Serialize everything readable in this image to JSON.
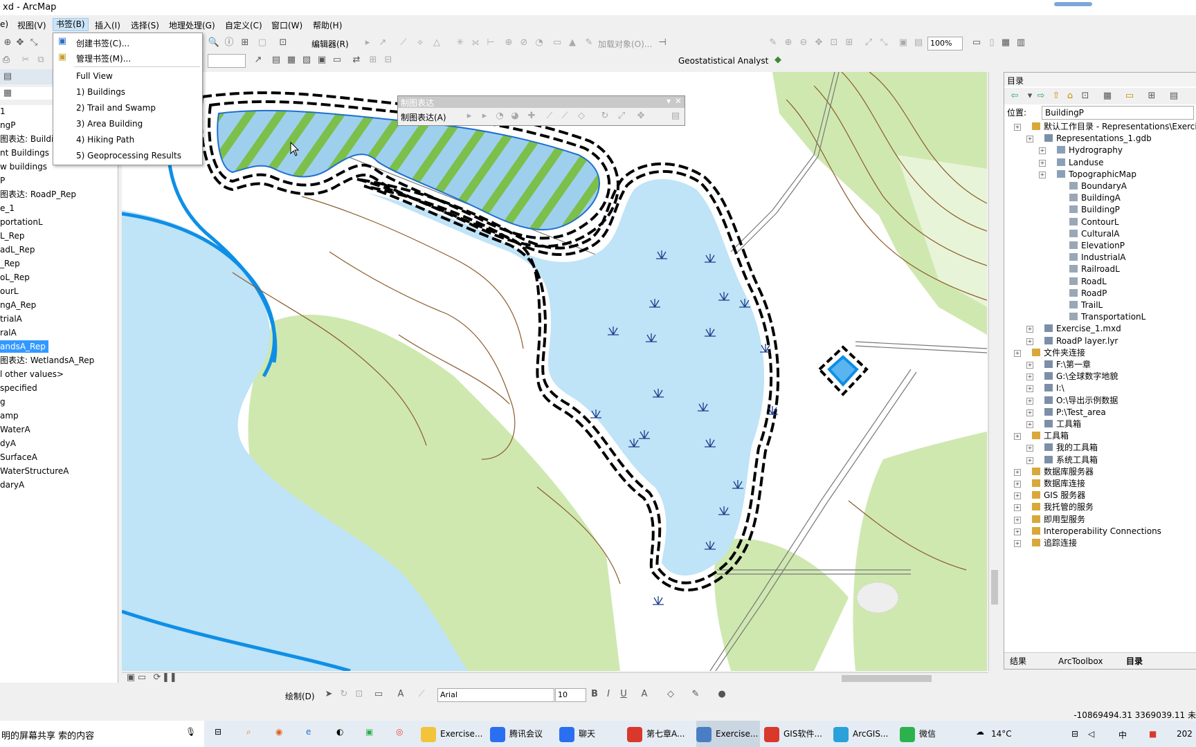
{
  "window": {
    "title": "xd - ArcMap"
  },
  "menu": [
    {
      "label": "视图(V)"
    },
    {
      "label": "书签(B)"
    },
    {
      "label": "插入(I)"
    },
    {
      "label": "选择(S)"
    },
    {
      "label": "地理处理(G)"
    },
    {
      "label": "自定义(C)"
    },
    {
      "label": "窗口(W)"
    },
    {
      "label": "帮助(H)"
    }
  ],
  "bookmarks_menu": {
    "create": "创建书签(C)...",
    "manage": "管理书签(M)...",
    "items": [
      "Full View",
      "1) Buildings",
      "2) Trail and Swamp",
      "3) Area Building",
      "4) Hiking Path",
      "5) Geoprocessing Results"
    ]
  },
  "toolbars": {
    "editor": "编辑器(R)",
    "add_data": "加载对象(O)...",
    "zoom": "100%",
    "geostat": "Geostatistical Analyst",
    "draw": "绘制(D)",
    "font": "Arial",
    "font_size": "10"
  },
  "floating_toolbar": {
    "title": "制图表达",
    "dropdown": "制图表达(A)"
  },
  "toc": {
    "items": [
      "1",
      "ngP",
      "图表达: Buildi",
      "nt Buildings",
      "w buildings",
      "P",
      "图表达: RoadP_Rep",
      "e_1",
      "portationL",
      "L_Rep",
      "adL_Rep",
      "_Rep",
      "oL_Rep",
      "ourL",
      "ngA_Rep",
      "trialA",
      "ralA",
      "andsA_Rep",
      "图表达: WetlandsA_Rep",
      "l other values>",
      "specified",
      "g",
      "amp",
      "WaterA",
      "dyA",
      "SurfaceA",
      "WaterStructureA",
      "daryA"
    ],
    "selected": "andsA_Rep"
  },
  "catalog": {
    "title": "目录",
    "location_label": "位置:",
    "location_value": "BuildingP",
    "tree": [
      {
        "label": "默认工作目录 - Representations\\Exercise_",
        "level": 0
      },
      {
        "label": "Representations_1.gdb",
        "level": 1
      },
      {
        "label": "Hydrography",
        "level": 2
      },
      {
        "label": "Landuse",
        "level": 2
      },
      {
        "label": "TopographicMap",
        "level": 2
      },
      {
        "label": "BoundaryA",
        "level": 3
      },
      {
        "label": "BuildingA",
        "level": 3
      },
      {
        "label": "BuildingP",
        "level": 3
      },
      {
        "label": "ContourL",
        "level": 3
      },
      {
        "label": "CulturalA",
        "level": 3
      },
      {
        "label": "ElevationP",
        "level": 3
      },
      {
        "label": "IndustrialA",
        "level": 3
      },
      {
        "label": "RailroadL",
        "level": 3
      },
      {
        "label": "RoadL",
        "level": 3
      },
      {
        "label": "RoadP",
        "level": 3
      },
      {
        "label": "TrailL",
        "level": 3
      },
      {
        "label": "TransportationL",
        "level": 3
      },
      {
        "label": "Exercise_1.mxd",
        "level": 1
      },
      {
        "label": "RoadP layer.lyr",
        "level": 1
      },
      {
        "label": "文件夹连接",
        "level": 0
      },
      {
        "label": "F:\\第一章",
        "level": 1
      },
      {
        "label": "G:\\全球数字地貌",
        "level": 1
      },
      {
        "label": "I:\\",
        "level": 1
      },
      {
        "label": "O:\\导出示例数据",
        "level": 1
      },
      {
        "label": "P:\\Test_area",
        "level": 1
      },
      {
        "label": "工具箱",
        "level": 1
      },
      {
        "label": "工具箱",
        "level": 0
      },
      {
        "label": "我的工具箱",
        "level": 1
      },
      {
        "label": "系统工具箱",
        "level": 1
      },
      {
        "label": "数据库服务器",
        "level": 0
      },
      {
        "label": "数据库连接",
        "level": 0
      },
      {
        "label": "GIS 服务器",
        "level": 0
      },
      {
        "label": "我托管的服务",
        "level": 0
      },
      {
        "label": "即用型服务",
        "level": 0
      },
      {
        "label": "Interoperability Connections",
        "level": 0
      },
      {
        "label": "追踪连接",
        "level": 0
      }
    ],
    "tabs": [
      "结果",
      "ArcToolbox",
      "目录"
    ]
  },
  "status": {
    "coords": "-10869494.31  3369039.11 未"
  },
  "taskbar": {
    "search_text": "明的屏幕共享 索的内容",
    "apps": [
      "Exercise...",
      "腾讯会议",
      "聊天",
      "第七章A...",
      "Exercise...",
      "GIS软件...",
      "ArcGIS...",
      "微信"
    ],
    "weather": "14°C",
    "ime": "中",
    "clock": "202"
  },
  "colors": {
    "water": "#bfe3f7",
    "deep_water": "#0e8fe6",
    "vegetation": "#cfe8b0",
    "contour": "#8b5a2b",
    "selection": "#3399ff"
  }
}
